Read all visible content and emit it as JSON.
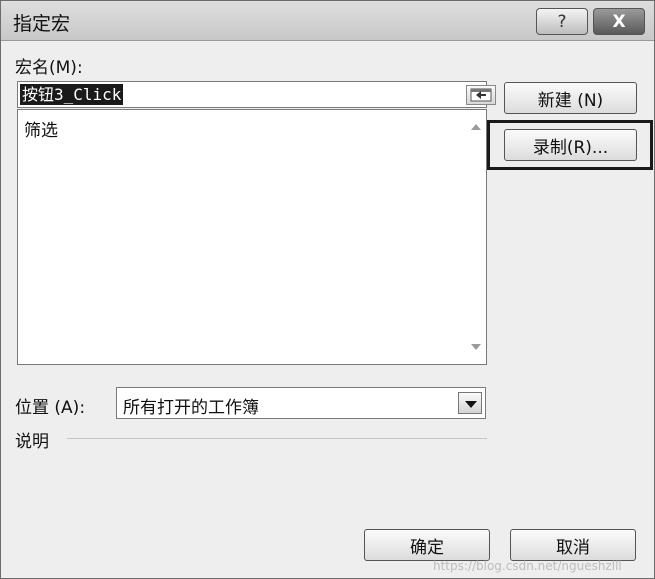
{
  "window": {
    "title": "指定宏",
    "help_label": "?",
    "close_label": "X"
  },
  "macro_name": {
    "label_prefix": "宏名",
    "label_key": "(M)",
    "label_suffix": ":",
    "value": "按钮3_Click"
  },
  "macro_list": {
    "items": [
      "筛选"
    ]
  },
  "buttons": {
    "new": "新建 (N)",
    "record": "录制(R)...",
    "ok": "确定",
    "cancel": "取消"
  },
  "location": {
    "label_prefix": "位置",
    "label_key": "(A)",
    "label_suffix": ":",
    "value": "所有打开的工作簿"
  },
  "description": {
    "label": "说明"
  },
  "watermark": "https://blog.csdn.net/ngueshzlll"
}
